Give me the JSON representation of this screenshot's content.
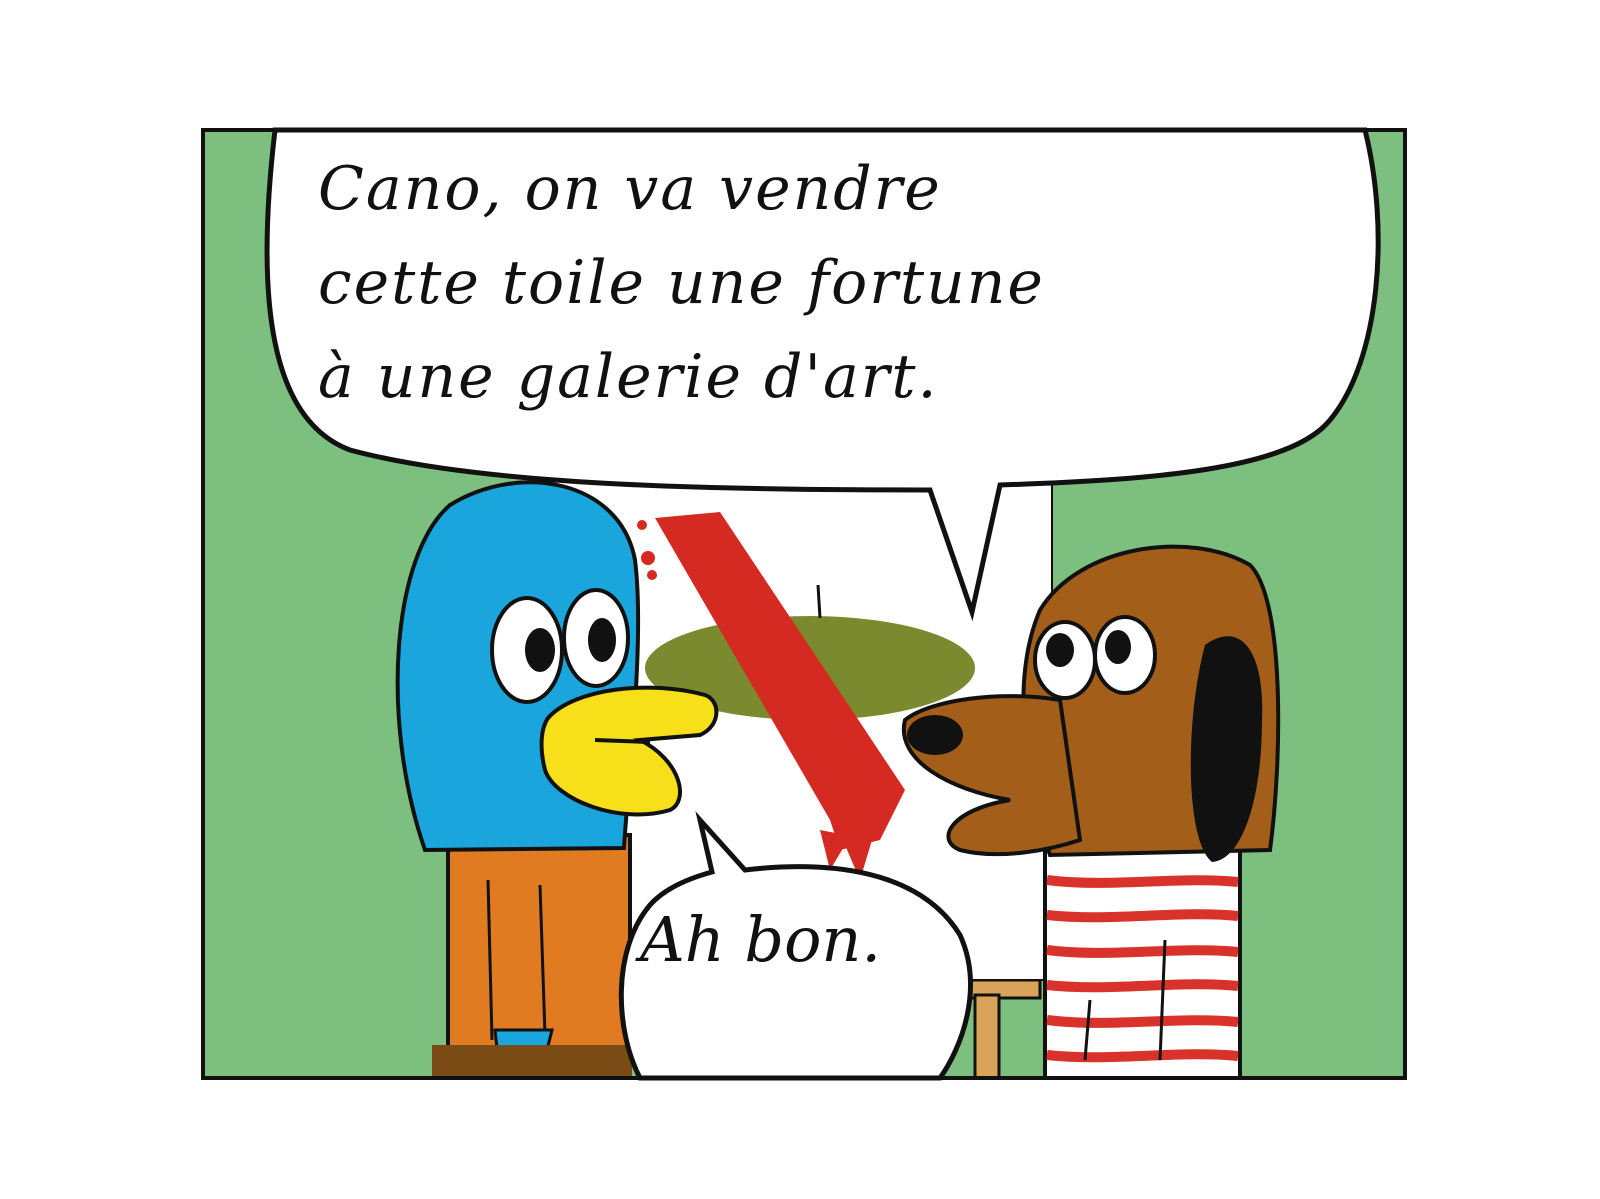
{
  "speech_bubbles": {
    "dog_line": "Cano, on va vendre\ncette toile une fortune\nà une galerie d'art.",
    "bird_reply": "Ah bon."
  },
  "colors": {
    "wall": "#7dbf7f",
    "bird_head": "#1aa6dc",
    "bird_beak": "#f7e01a",
    "bird_body": "#e07b22",
    "dog_fur": "#a35f1a",
    "dog_ear": "#111111",
    "shirt_stripe": "#d9322a",
    "paint_stroke": "#d42a22",
    "paint_blob": "#7c8a2f",
    "canvas": "#ffffff",
    "easel": "#d9a35a",
    "outline": "#111111"
  },
  "characters": [
    {
      "id": "bird",
      "icon": "blue-bird"
    },
    {
      "id": "dog",
      "icon": "brown-dog"
    }
  ]
}
